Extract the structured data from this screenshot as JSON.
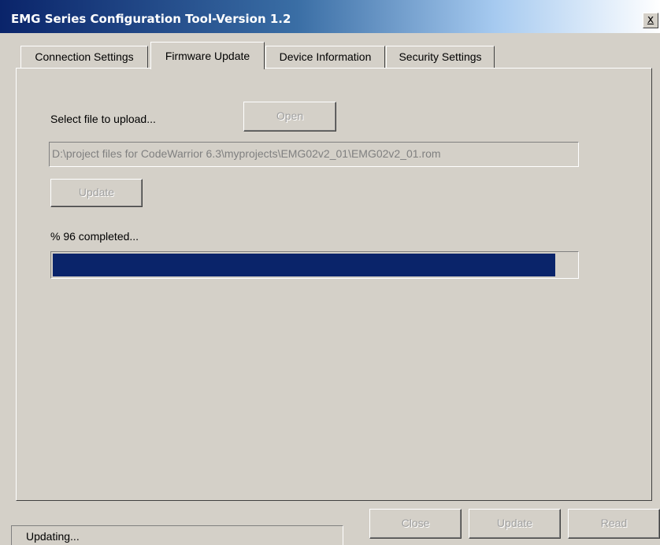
{
  "window": {
    "title": "EMG Series Configuration Tool-Version 1.2",
    "close_label": "x"
  },
  "tabs": [
    {
      "label": "Connection Settings",
      "active": false
    },
    {
      "label": "Firmware Update",
      "active": true
    },
    {
      "label": "Device Information",
      "active": false
    },
    {
      "label": "Security Settings",
      "active": false
    }
  ],
  "firmware": {
    "select_label": "Select file to upload...",
    "open_label": "Open",
    "file_path": "D:\\project files for CodeWarrior 6.3\\myprojects\\EMG02v2_01\\EMG02v2_01.rom",
    "update_label": "Update",
    "progress_text": "% 96 completed...",
    "progress_percent": 96
  },
  "footer": {
    "status_text": "Updating...",
    "close_label": "Close",
    "update_label": "Update",
    "read_label": "Read"
  },
  "colors": {
    "progress_fill": "#0a246a",
    "titlebar_start": "#0a246a",
    "face": "#d4d0c8"
  }
}
